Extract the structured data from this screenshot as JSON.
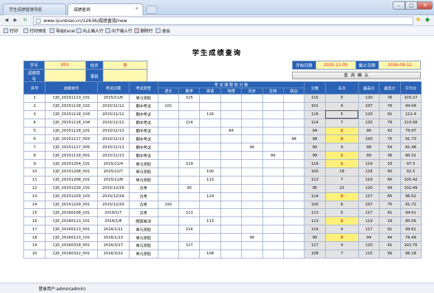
{
  "browser": {
    "tabs": [
      {
        "label": "学生成绩管理导航"
      },
      {
        "label": "成绩查询"
      }
    ],
    "url": "www.iyunbiao.cn/12636/成绩查询/new"
  },
  "toolbar": [
    {
      "label": "打印",
      "icon": "printer-icon"
    },
    {
      "label": "打印预览",
      "icon": "print-preview-icon"
    },
    {
      "label": "导出Excel",
      "icon": "excel-icon"
    },
    {
      "label": "向上插入行",
      "icon": "insert-above-icon"
    },
    {
      "label": "向下插入行",
      "icon": "insert-below-icon"
    },
    {
      "label": "删除行",
      "icon": "delete-row-icon"
    },
    {
      "label": "退出",
      "icon": "exit-icon"
    }
  ],
  "page": {
    "title": "学生成绩查询",
    "filter": {
      "student_no_label": "学号",
      "student_no": "055",
      "name_label": "姓名",
      "name": "李",
      "record_no_label": "成绩单号",
      "record_no": "",
      "course_label": "课目",
      "course": "",
      "start_label": "开始日期",
      "start_date": "2015-11-05",
      "end_label": "截止日期",
      "end_date": "2016-09-12",
      "confirm_label": "查 询 确 认"
    },
    "columns": {
      "index": "序号",
      "record_no": "成绩单号",
      "date": "考试日期",
      "type": "考试类型",
      "subjects_group": "考 试 课 程 和 分 数",
      "subjects": [
        "语文",
        "数学",
        "英语",
        "地理",
        "历史",
        "生物",
        "政治"
      ],
      "score": "分数",
      "rank": "名次",
      "max": "最高分",
      "min": "最低分",
      "avg": "平均分"
    },
    "rows": [
      {
        "idx": "1",
        "no": "CJD_20151113_101",
        "date": "2015/11/6",
        "type": "单元测验",
        "s": [
          "",
          "115",
          "",
          "",
          "",
          "",
          ""
        ],
        "score": "115",
        "rank": "5",
        "max": "120",
        "min": "76",
        "avg": "103.27"
      },
      {
        "idx": "2",
        "no": "CJD_20151118_102",
        "date": "2015/11/12",
        "type": "期中考试",
        "s": [
          "101",
          "",
          "",
          "",
          "",
          "",
          ""
        ],
        "score": "101",
        "rank": "4",
        "max": "107",
        "min": "76",
        "avg": "94.04"
      },
      {
        "idx": "3",
        "no": "CJD_20151118_103",
        "date": "2015/11/12",
        "type": "期中考试",
        "s": [
          "",
          "",
          "116",
          "",
          "",
          "",
          ""
        ],
        "score": "116",
        "rank": "5",
        "max": "120",
        "min": "91",
        "avg": "112.4"
      },
      {
        "idx": "4",
        "no": "CJD_20151118_104",
        "date": "2015/11/12",
        "type": "期中考试",
        "s": [
          "",
          "114",
          "",
          "",
          "",
          "",
          ""
        ],
        "score": "114",
        "rank": "7",
        "max": "120",
        "min": "79",
        "avg": "110.58"
      },
      {
        "idx": "5",
        "no": "CJD_20151118_101",
        "date": "2015/11/13",
        "type": "期中考试",
        "s": [
          "",
          "",
          "",
          "94",
          "",
          "",
          ""
        ],
        "score": "94",
        "rank": "2",
        "max": "96",
        "min": "42",
        "avg": "79.97"
      },
      {
        "idx": "6",
        "no": "CJD_20151117_003",
        "date": "2015/11/13",
        "type": "期中考试",
        "s": [
          "",
          "",
          "",
          "",
          "",
          "",
          "98"
        ],
        "score": "98",
        "rank": "3",
        "max": "100",
        "min": "75",
        "avg": "91.73"
      },
      {
        "idx": "7",
        "no": "CJD_20151117_005",
        "date": "2015/11/13",
        "type": "期中考试",
        "s": [
          "",
          "",
          "",
          "",
          "90",
          "",
          ""
        ],
        "score": "90",
        "rank": "9",
        "max": "98",
        "min": "54",
        "avg": "81.48"
      },
      {
        "idx": "8",
        "no": "CJD_20151118_001",
        "date": "2015/11/13",
        "type": "期中考试",
        "s": [
          "",
          "",
          "",
          "",
          "",
          "99",
          ""
        ],
        "score": "99",
        "rank": "1",
        "max": "99",
        "min": "36",
        "avg": "80.31"
      },
      {
        "idx": "9",
        "no": "CJD_20151204_101",
        "date": "2015/12/4",
        "type": "单元测验",
        "s": [
          "",
          "119",
          "",
          "",
          "",
          "",
          ""
        ],
        "score": "119",
        "rank": "1",
        "max": "119",
        "min": "33",
        "avg": "97.3"
      },
      {
        "idx": "10",
        "no": "CJD_20151208_001",
        "date": "2015/12/7",
        "type": "单元测验",
        "s": [
          "",
          "",
          "100",
          "",
          "",
          "",
          ""
        ],
        "score": "100",
        "rank": "18",
        "max": "118",
        "min": "40",
        "avg": "92.3"
      },
      {
        "idx": "11",
        "no": "CJD_20151208_101",
        "date": "2015/12/8",
        "type": "单元测验",
        "s": [
          "",
          "",
          "113",
          "",
          "",
          "",
          ""
        ],
        "score": "113",
        "rank": "7",
        "max": "119",
        "min": "60",
        "avg": "105.42"
      },
      {
        "idx": "12",
        "no": "CJD_20151229_102",
        "date": "2015/12/29",
        "type": "月考",
        "s": [
          "",
          "95",
          "",
          "",
          "",
          "",
          ""
        ],
        "score": "95",
        "rank": "22",
        "max": "120",
        "min": "49",
        "avg": "102.49"
      },
      {
        "idx": "13",
        "no": "CJD_20151229_103",
        "date": "2015/12/29",
        "type": "月考",
        "s": [
          "",
          "",
          "114",
          "",
          "",
          "",
          ""
        ],
        "score": "114",
        "rank": "3",
        "max": "117",
        "min": "65",
        "avg": "96.52"
      },
      {
        "idx": "14",
        "no": "CJD_20151229_001",
        "date": "2015/12/29",
        "type": "月考",
        "s": [
          "100",
          "",
          "",
          "",
          "",
          "",
          ""
        ],
        "score": "100",
        "rank": "6",
        "max": "107",
        "min": "75",
        "avg": "91.72"
      },
      {
        "idx": "15",
        "no": "CJD_20160108_101",
        "date": "2016/1/7",
        "type": "月考",
        "s": [
          "",
          "113",
          "",
          "",
          "",
          "",
          ""
        ],
        "score": "113",
        "rank": "5",
        "max": "117",
        "min": "41",
        "avg": "94.51"
      },
      {
        "idx": "16",
        "no": "CJD_20160113_101",
        "date": "2016/1/8",
        "type": "随周单词",
        "s": [
          "",
          "",
          "113",
          "",
          "",
          "",
          ""
        ],
        "score": "113",
        "rank": "2",
        "max": "119",
        "min": "19",
        "avg": "80.56"
      },
      {
        "idx": "17",
        "no": "CJD_20160113_001",
        "date": "2016/1/11",
        "type": "单元测验",
        "s": [
          "",
          "114",
          "",
          "",
          "",
          "",
          ""
        ],
        "score": "114",
        "rank": "4",
        "max": "117",
        "min": "61",
        "avg": "99.61"
      },
      {
        "idx": "18",
        "no": "CJD_20160113_102",
        "date": "2016/1/13",
        "type": "单元测验",
        "s": [
          "",
          "",
          "",
          "",
          "90",
          "",
          ""
        ],
        "score": "90",
        "rank": "3",
        "max": "94",
        "min": "44",
        "avg": "76.49"
      },
      {
        "idx": "19",
        "no": "CJD_20160318_001",
        "date": "2016/3/17",
        "type": "单元测验",
        "s": [
          "",
          "117",
          "",
          "",
          "",
          "",
          ""
        ],
        "score": "117",
        "rank": "4",
        "max": "120",
        "min": "41",
        "avg": "102.75"
      },
      {
        "idx": "20",
        "no": "CJD_20160322_001",
        "date": "2016/3/22",
        "type": "单元测验",
        "s": [
          "",
          "",
          "108",
          "",
          "",
          "",
          ""
        ],
        "score": "108",
        "rank": "7",
        "max": "115",
        "min": "56",
        "avg": "96.18"
      }
    ],
    "highlight_ranks": [
      "1",
      "2",
      "3"
    ],
    "selected_row": "3"
  },
  "status": {
    "text": "登录用户:admin(admin)"
  },
  "colors": {
    "header_blue": "#2a63b5",
    "highlight_yellow": "#fff07a",
    "value_red": "#d91a1a"
  }
}
